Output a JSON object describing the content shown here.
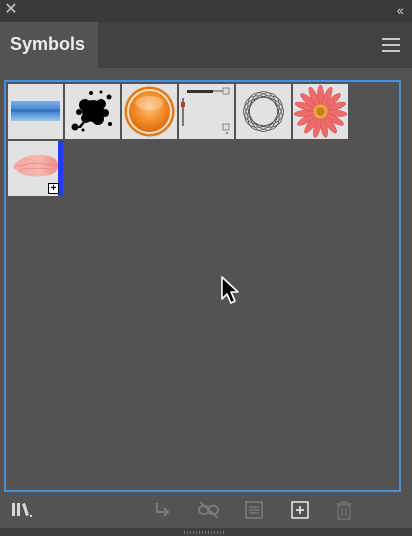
{
  "window": {
    "close_icon": "close-icon",
    "collapse_icon": "collapse-panels-icon",
    "collapse_glyph": "‹‹"
  },
  "panel": {
    "tab_label": "Symbols",
    "menu_icon": "hamburger-menu-icon",
    "accent_color": "#4b8ed6"
  },
  "symbols": [
    {
      "name": "blue-banner",
      "icon": "blue-banner-icon"
    },
    {
      "name": "ink-splat",
      "icon": "ink-splat-icon"
    },
    {
      "name": "orange-button",
      "icon": "orange-button-icon"
    },
    {
      "name": "slider-ui",
      "icon": "slider-ui-icon"
    },
    {
      "name": "wire-ring",
      "icon": "wire-ring-icon"
    },
    {
      "name": "flower",
      "icon": "flower-icon"
    },
    {
      "name": "petal",
      "icon": "petal-icon",
      "selected": true,
      "new_badge": "+"
    }
  ],
  "toolbar": [
    {
      "name": "symbol-libraries-menu",
      "icon": "libraries-icon",
      "enabled": true
    },
    {
      "name": "place-symbol-instance",
      "icon": "place-instance-icon",
      "enabled": false
    },
    {
      "name": "break-link-to-symbol",
      "icon": "break-link-icon",
      "enabled": false
    },
    {
      "name": "symbol-options",
      "icon": "symbol-options-icon",
      "enabled": false
    },
    {
      "name": "new-symbol",
      "icon": "new-symbol-icon",
      "enabled": true
    },
    {
      "name": "delete-symbol",
      "icon": "trash-icon",
      "enabled": false
    }
  ]
}
